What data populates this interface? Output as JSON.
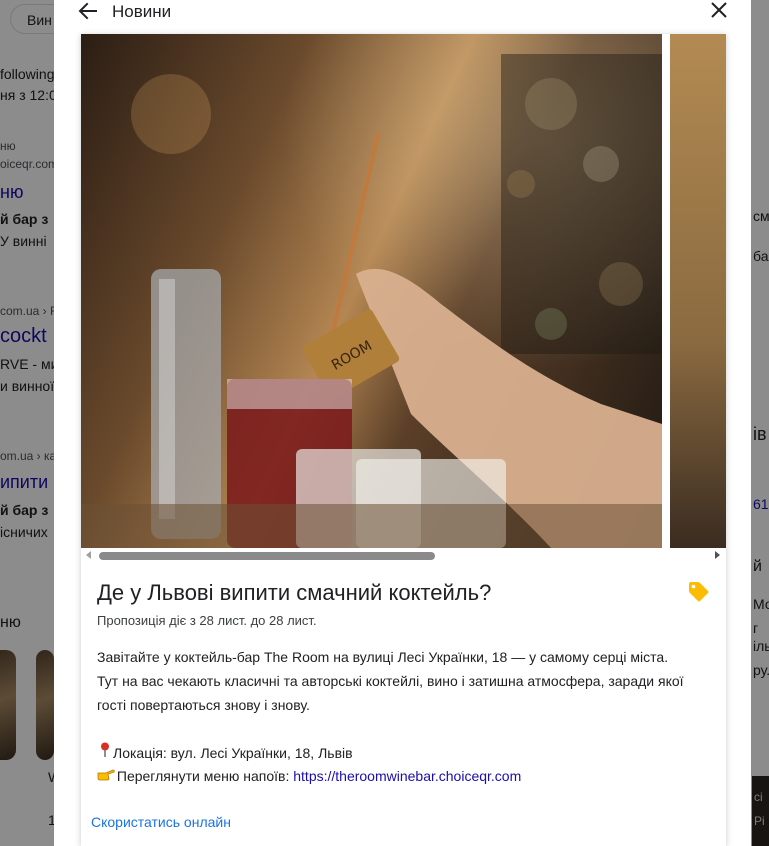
{
  "background": {
    "chip": "Вин",
    "snippets": [
      "following,",
      "ня з 12:0",
      "ню",
      "oiceqr.com",
      "ню",
      "й бар з",
      "У винні",
      "com.ua › F",
      "cockt",
      "RVE - ми",
      "и винної",
      "om.ua › ка",
      "ипити в",
      "й бар з",
      "існичих",
      "ню",
      "W",
      "1"
    ],
    "right_snippets": [
      "см",
      "ба",
      "ів",
      "61",
      "й",
      "Мо",
      "г",
      "іль",
      "ру.",
      "сі",
      "Pi"
    ]
  },
  "modal": {
    "title": "Новини",
    "post": {
      "title": "Де у Львові випити смачний коктейль?",
      "validity": "Пропозиція діє з 28 лист. до 28 лист.",
      "body": [
        "Завітайте у коктейль-бар The Room на вулиці Лесі Українки, 18 — у самому серці міста.",
        "Тут на вас чекають класичні та авторські коктейлі, вино і затишна атмосфера, заради якої",
        "гості повертаються знову і знову."
      ],
      "location_label": "Локація: вул. Лесі Українки, 18, Львів",
      "menu_label": "Переглянути меню напоїв:",
      "menu_link": "https://theroomwinebar.choiceqr.com",
      "cta": "Скористатись онлайн",
      "photo_text": "ROOM"
    }
  },
  "colors": {
    "link": "#1a0dab",
    "cta": "#1a73e8",
    "tag": "#fbbc04"
  }
}
